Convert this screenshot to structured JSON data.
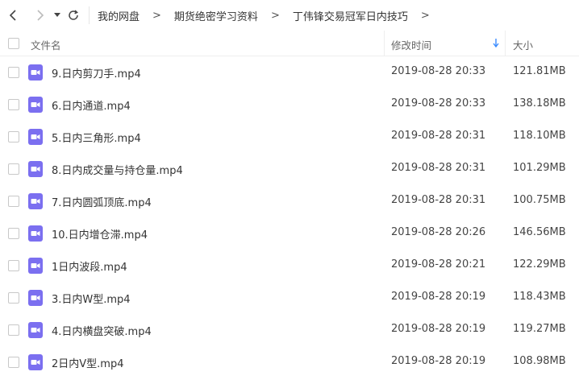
{
  "breadcrumb": [
    "我的网盘",
    "期货绝密学习资料",
    "丁伟锋交易冠军日内技巧"
  ],
  "breadcrumb_sep": ">",
  "header": {
    "name": "文件名",
    "time": "修改时间",
    "size": "大小"
  },
  "colors": {
    "icon_purple": "#7b6ff0",
    "sort_arrow": "#3b8cff"
  },
  "files": [
    {
      "name": "9.日内剪刀手.mp4",
      "time": "2019-08-28 20:33",
      "size": "121.81MB"
    },
    {
      "name": "6.日内通道.mp4",
      "time": "2019-08-28 20:33",
      "size": "138.18MB"
    },
    {
      "name": "5.日内三角形.mp4",
      "time": "2019-08-28 20:31",
      "size": "118.10MB"
    },
    {
      "name": "8.日内成交量与持仓量.mp4",
      "time": "2019-08-28 20:31",
      "size": "101.29MB"
    },
    {
      "name": "7.日内圆弧顶底.mp4",
      "time": "2019-08-28 20:31",
      "size": "100.75MB"
    },
    {
      "name": "10.日内增仓滞.mp4",
      "time": "2019-08-28 20:26",
      "size": "146.56MB"
    },
    {
      "name": "1日内波段.mp4",
      "time": "2019-08-28 20:21",
      "size": "122.29MB"
    },
    {
      "name": "3.日内W型.mp4",
      "time": "2019-08-28 20:19",
      "size": "118.43MB"
    },
    {
      "name": "4.日内横盘突破.mp4",
      "time": "2019-08-28 20:19",
      "size": "119.27MB"
    },
    {
      "name": "2日内V型.mp4",
      "time": "2019-08-28 20:19",
      "size": "108.98MB"
    }
  ]
}
